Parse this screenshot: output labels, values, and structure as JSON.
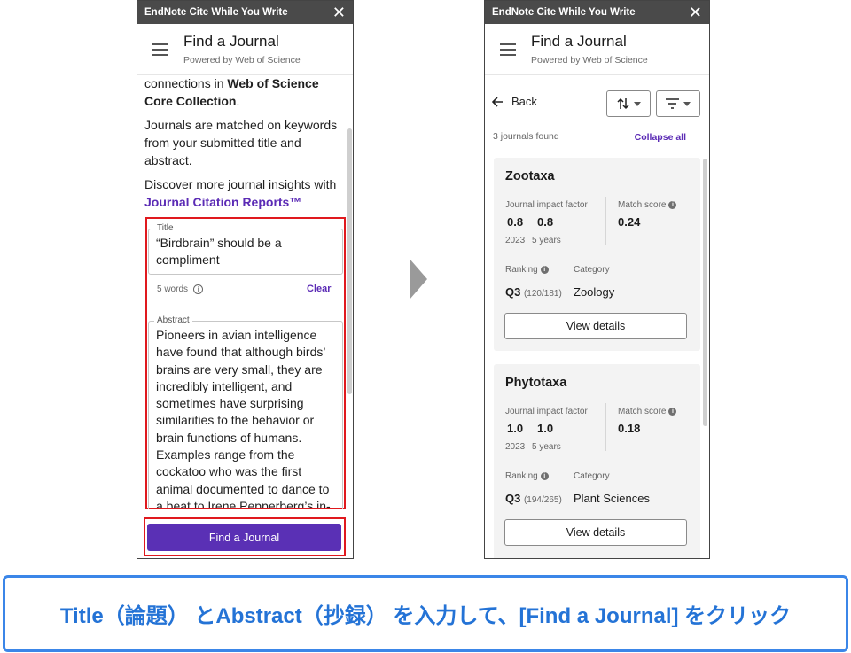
{
  "left": {
    "window_title": "EndNote Cite While You Write",
    "header_title": "Find a Journal",
    "header_subtitle": "Powered by Web of Science",
    "intro1_pre": "connections in ",
    "intro1_bold": "Web of Science Core Collection",
    "intro1_post": ".",
    "intro2": "Journals are matched on keywords from your submitted title and abstract.",
    "intro3": "Discover more journal insights with",
    "jcr_link": "Journal Citation Reports™",
    "title_legend": "Title",
    "title_value": "“Birdbrain” should be a compliment",
    "word_count": "5 words",
    "clear_label": "Clear",
    "abstract_legend": "Abstract",
    "abstract_value": "Pioneers in avian intelligence have found that although birds’ brains are very small, they are incredibly intelligent, and sometimes have surprising similarities to the behavior or brain functions of humans. Examples range from the cockatoo who was the first animal documented to dance to a beat to Irene Pepperberg’s in-",
    "find_button": "Find a Journal"
  },
  "right": {
    "window_title": "EndNote Cite While You Write",
    "header_title": "Find a Journal",
    "header_subtitle": "Powered by Web of Science",
    "back_label": "Back",
    "found_text": "3 journals found",
    "collapse_label": "Collapse all",
    "impact_label": "Journal impact factor",
    "match_label": "Match score",
    "ranking_label": "Ranking",
    "category_label": "Category",
    "year_label": "2023",
    "five_year_label": "5 years",
    "view_details": "View details",
    "journals": [
      {
        "name": "Zootaxa",
        "if_2023": "0.8",
        "if_5y": "0.8",
        "match": "0.24",
        "quartile": "Q3",
        "rank": "(120/181)",
        "category": "Zoology"
      },
      {
        "name": "Phytotaxa",
        "if_2023": "1.0",
        "if_5y": "1.0",
        "match": "0.18",
        "quartile": "Q3",
        "rank": "(194/265)",
        "category": "Plant Sciences"
      }
    ]
  },
  "caption": "Title（論題） とAbstract（抄録） を入力して、[Find a Journal] をクリック",
  "colors": {
    "accent": "#5a30b5",
    "highlight": "#e0191e",
    "caption": "#2473d6"
  }
}
